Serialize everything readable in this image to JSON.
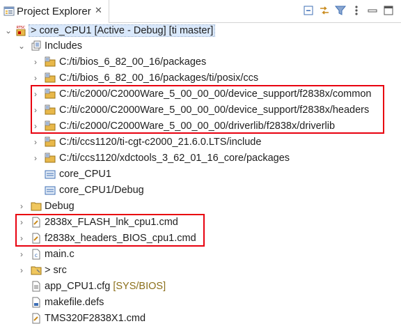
{
  "panel": {
    "title": "Project Explorer",
    "close_glyph": "✕"
  },
  "toolbar": {
    "icons": [
      "collapse-all-icon",
      "link-with-editor-icon",
      "filter-icon",
      "view-menu-icon",
      "minimize-icon",
      "maximize-icon"
    ]
  },
  "project": {
    "name": "> core_CPU1",
    "decoration": " [Active - Debug] [ti master]",
    "rtsc_badge": "RTSC"
  },
  "tree": {
    "includes": "Includes",
    "include_paths": [
      "C:/ti/bios_6_82_00_16/packages",
      "C:/ti/bios_6_82_00_16/packages/ti/posix/ccs",
      "C:/ti/c2000/C2000Ware_5_00_00_00/device_support/f2838x/common",
      "C:/ti/c2000/C2000Ware_5_00_00_00/device_support/f2838x/headers",
      "C:/ti/c2000/C2000Ware_5_00_00_00/driverlib/f2838x/driverlib",
      "C:/ti/ccs1120/ti-cgt-c2000_21.6.0.LTS/include",
      "C:/ti/ccs1120/xdctools_3_62_01_16_core/packages",
      "core_CPU1",
      "core_CPU1/Debug"
    ],
    "debug_folder": "Debug",
    "cmd_files": [
      "2838x_FLASH_lnk_cpu1.cmd",
      "f2838x_headers_BIOS_cpu1.cmd"
    ],
    "main_c": "main.c",
    "src_folder": "> src",
    "cfg_file": "app_CPU1.cfg",
    "cfg_tag": "[SYS/BIOS]",
    "makefile": "makefile.defs",
    "cmd_main": "TMS320F2838X1.cmd"
  },
  "colors": {
    "highlight_box": "#e8000f",
    "selection": "#d9e8fb",
    "folder": "#e8b84a"
  }
}
